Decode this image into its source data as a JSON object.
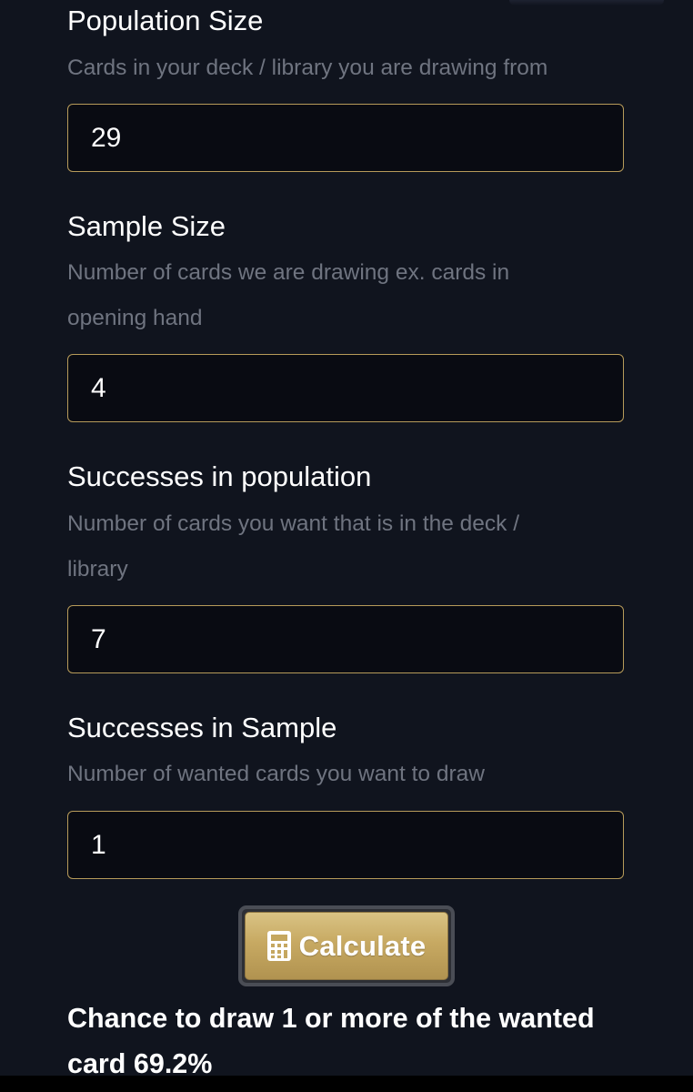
{
  "fields": [
    {
      "label": "Population Size",
      "help": "Cards in your deck / library you are drawing from",
      "value": "29"
    },
    {
      "label": "Sample Size",
      "help": "Number of cards we are drawing ex. cards in opening hand",
      "value": "4"
    },
    {
      "label": "Successes in population",
      "help": "Number of cards you want that is in the deck / library",
      "value": "7"
    },
    {
      "label": "Successes in Sample",
      "help": "Number of wanted cards you want to draw",
      "value": "1"
    }
  ],
  "button": {
    "label": "Calculate",
    "icon": "calculator-icon"
  },
  "result": {
    "text": "Chance to draw 1 or more of the wanted card 69.2%"
  },
  "colors": {
    "background": "#10141e",
    "input_background": "#090b12",
    "input_border": "#b79b5a",
    "help_text": "#6f7480",
    "accent_gold": "#c7a962"
  }
}
